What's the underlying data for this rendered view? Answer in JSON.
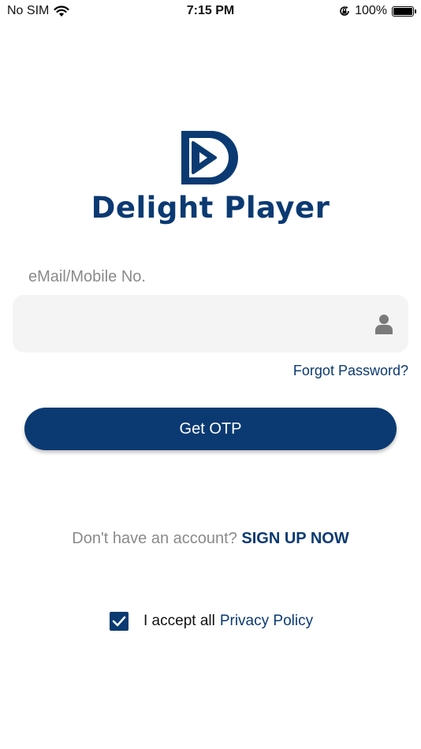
{
  "status_bar": {
    "carrier": "No SIM",
    "time": "7:15 PM",
    "battery_percent": "100%",
    "battery_level": 1.0,
    "icons": [
      "wifi-icon",
      "orientation-lock-icon",
      "battery-icon"
    ]
  },
  "brand": {
    "logo_icon": "play-d-logo-icon",
    "name": "Delight Player",
    "color": "#0b3a72"
  },
  "login_form": {
    "field_label": "eMail/Mobile No.",
    "field_value": "",
    "field_icon": "user-icon",
    "forgot_password": "Forgot Password?",
    "submit_label": "Get OTP"
  },
  "signup": {
    "prompt": "Don't have an account?",
    "link": "SIGN UP NOW"
  },
  "terms": {
    "checked": true,
    "text": "I accept all",
    "link": "Privacy Policy"
  },
  "colors": {
    "primary": "#0b3a72",
    "muted_text": "#8a8a8a",
    "input_background": "#f4f4f4"
  }
}
